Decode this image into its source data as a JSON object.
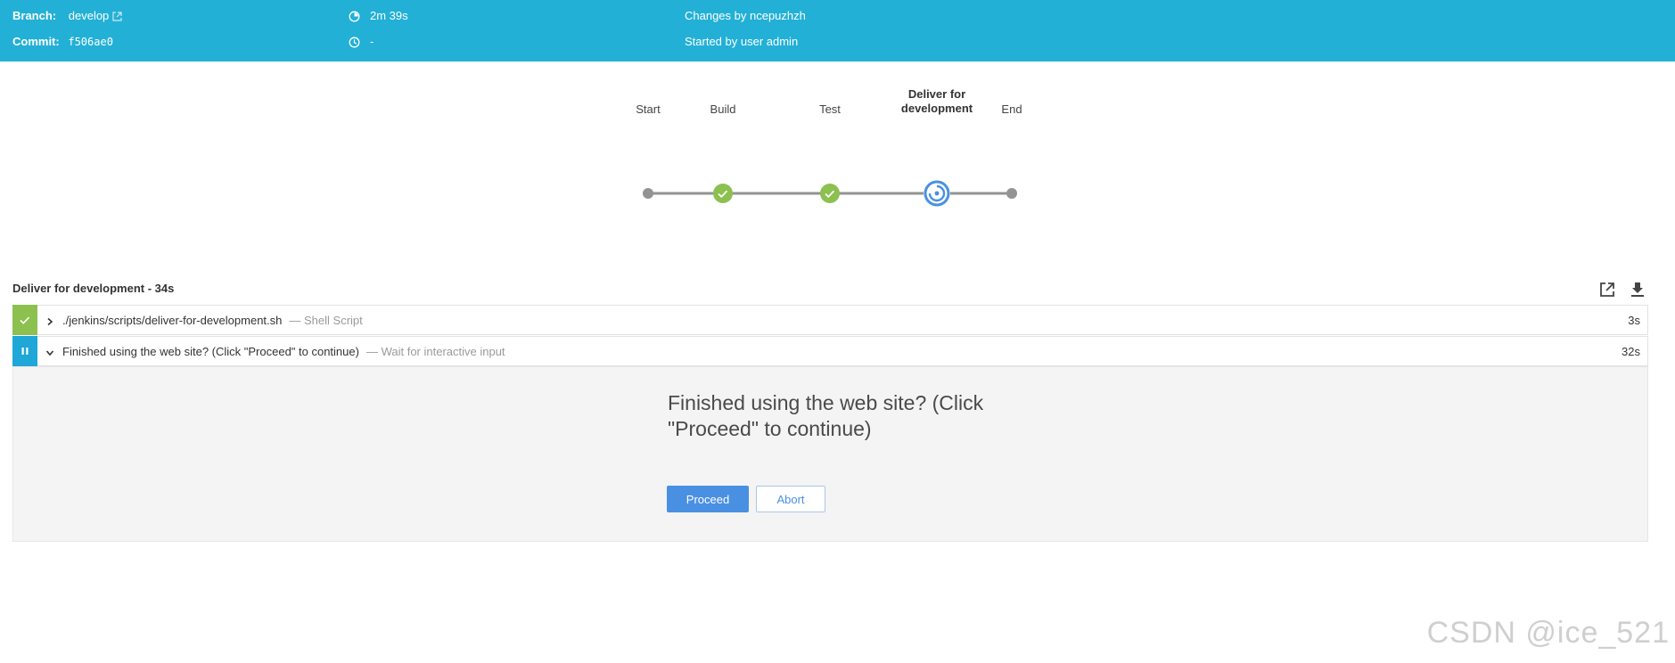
{
  "header": {
    "branch_label": "Branch:",
    "branch_value": "develop",
    "commit_label": "Commit:",
    "commit_value": "f506ae0",
    "duration": "2m 39s",
    "started_time": "-",
    "changes": "Changes by ncepuzhzh",
    "started_by": "Started by user admin",
    "icons": [
      "external-link-icon",
      "duration-icon",
      "clock-icon"
    ]
  },
  "pipeline": {
    "stages": [
      {
        "label": "Start",
        "status": "start"
      },
      {
        "label": "Build",
        "status": "success"
      },
      {
        "label": "Test",
        "status": "success"
      },
      {
        "label": "Deliver for development",
        "label_line1": "Deliver for",
        "label_line2": "development",
        "status": "running"
      },
      {
        "label": "End",
        "status": "end"
      }
    ],
    "colors": {
      "success": "#8cc04f",
      "running": "#4a90e2",
      "node": "#949393",
      "line": "#949393"
    }
  },
  "steps_panel": {
    "title": "Deliver for development - 34s",
    "icons": [
      "open-in-new-icon",
      "download-icon"
    ],
    "steps": [
      {
        "text": "./jenkins/scripts/deliver-for-development.sh",
        "sub": "— Shell Script",
        "duration": "3s",
        "status": "success",
        "expanded": false
      },
      {
        "text": "Finished using the web site? (Click \"Proceed\" to continue)",
        "sub": "— Wait for interactive input",
        "duration": "32s",
        "status": "paused",
        "expanded": true
      }
    ]
  },
  "input": {
    "message": "Finished using the web site? (Click \"Proceed\" to continue)",
    "proceed_label": "Proceed",
    "abort_label": "Abort"
  },
  "watermark": "CSDN @ice_521",
  "colors": {
    "header_bg": "#23b0d6",
    "primary": "#4a90e2",
    "success": "#8cc04f",
    "paused": "#1ea7d7"
  }
}
